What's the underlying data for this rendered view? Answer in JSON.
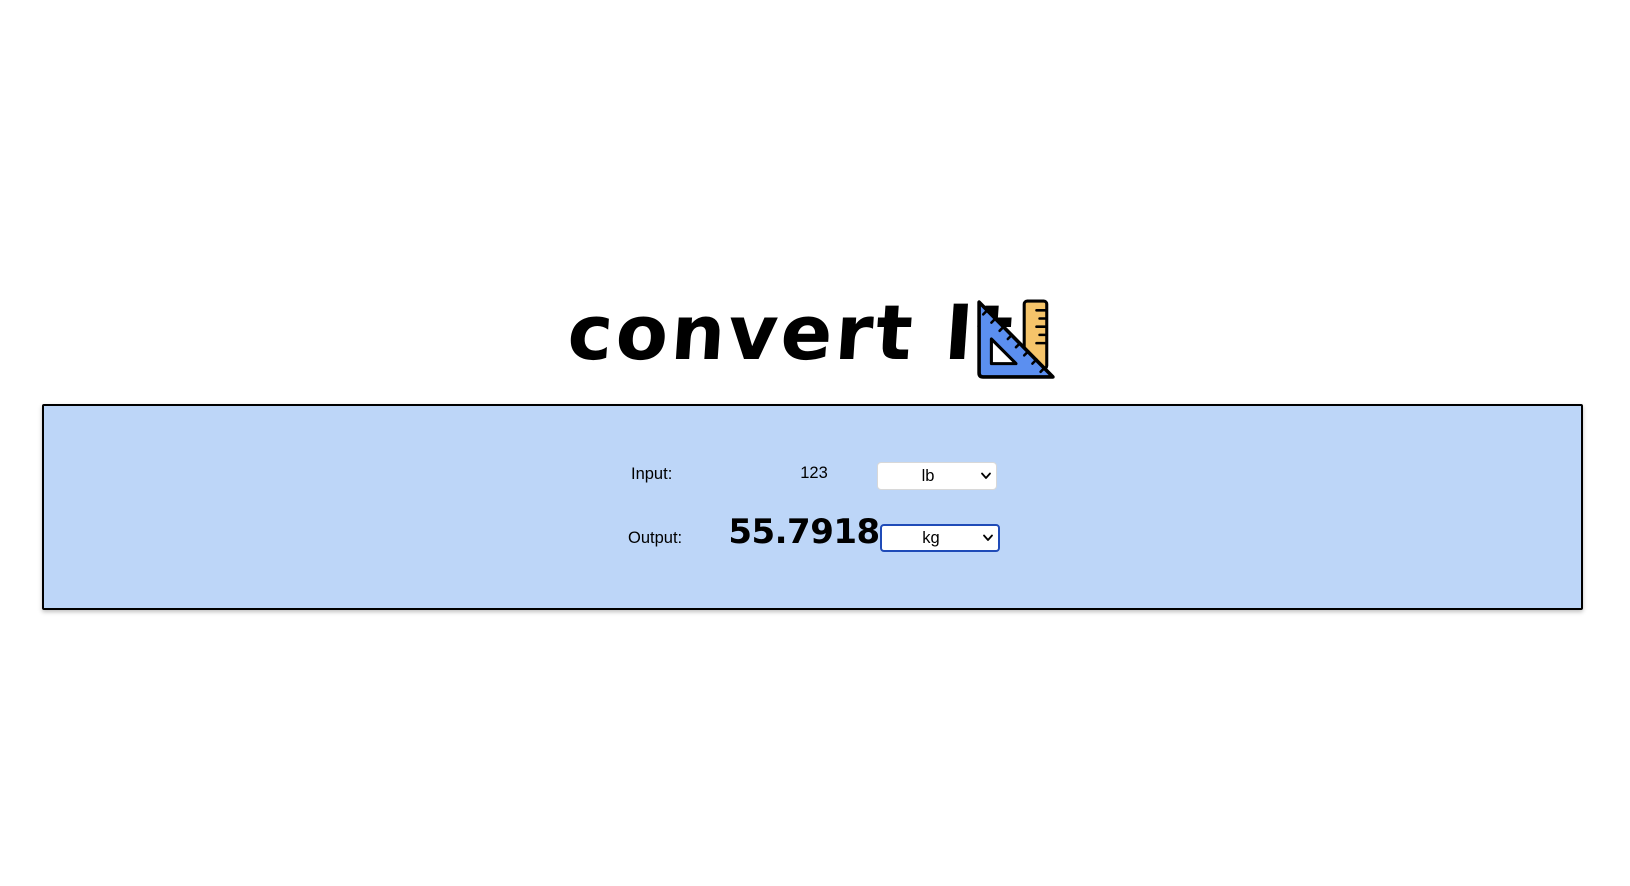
{
  "header": {
    "title": "convert It!",
    "icon": "ruler-triangle-icon"
  },
  "converter": {
    "input_label": "Input:",
    "input_value": "123",
    "input_unit": "lb",
    "output_label": "Output:",
    "output_value": "55.7918",
    "output_unit": "kg"
  },
  "colors": {
    "panel_background": "#bdd6f8",
    "triangle_blue": "#5b8ff0",
    "ruler_orange": "#f5c46a",
    "focus_border": "#1f4bb8"
  }
}
